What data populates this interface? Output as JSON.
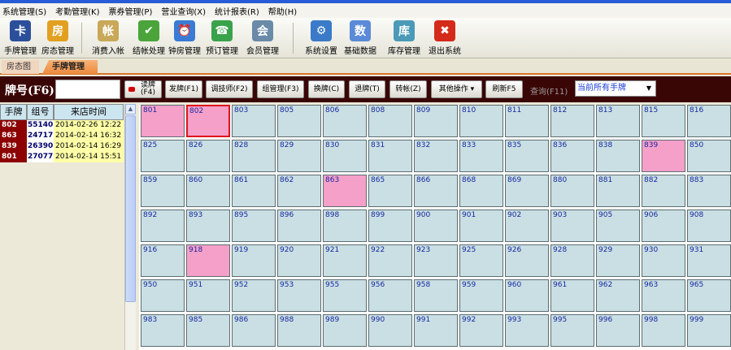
{
  "menu": [
    "系统管理(S)",
    "考勤管理(K)",
    "票券管理(P)",
    "营业查询(X)",
    "统计报表(R)",
    "帮助(H)"
  ],
  "toolbar": [
    {
      "label": "手牌管理",
      "icon": "hand-card-icon",
      "color": "#2c4f9b",
      "glyph": "卡"
    },
    {
      "label": "房态管理",
      "icon": "room-state-icon",
      "color": "#e2a020",
      "glyph": "房"
    },
    {
      "label": "消费入帐",
      "icon": "clipboard-icon",
      "color": "#c9a858",
      "glyph": "帐"
    },
    {
      "label": "结帐处理",
      "icon": "checkmark-icon",
      "color": "#4aa43a",
      "glyph": "✔"
    },
    {
      "label": "钟房管理",
      "icon": "clock-icon",
      "color": "#3a7bd5",
      "glyph": "⏰"
    },
    {
      "label": "预订管理",
      "icon": "phone-icon",
      "color": "#3aa24a",
      "glyph": "☎"
    },
    {
      "label": "会员管理",
      "icon": "member-icon",
      "color": "#6a8aa8",
      "glyph": "会"
    },
    {
      "label": "系统设置",
      "icon": "settings-icon",
      "color": "#3a7ac8",
      "glyph": "⚙"
    },
    {
      "label": "基础数据",
      "icon": "data-search-icon",
      "color": "#5a8ad8",
      "glyph": "数"
    },
    {
      "label": "库存管理",
      "icon": "inventory-icon",
      "color": "#4a9ab8",
      "glyph": "库"
    },
    {
      "label": "退出系统",
      "icon": "exit-icon",
      "color": "#d42a1a",
      "glyph": "✖"
    }
  ],
  "tabs": {
    "room_state": "房态图",
    "card_management": "手牌管理"
  },
  "query": {
    "card_label": "牌号(F6)",
    "card_input": "",
    "read_line1": "读牌",
    "read_line2": "(F4)",
    "buttons": [
      "发牌(F1)",
      "调技师(F2)",
      "组管理(F3)",
      "换牌(C)",
      "退牌(T)",
      "转帐(Z)",
      "其他操作 ▾",
      "刷新F5"
    ],
    "query_label": "查询(F11)",
    "filter_value": "当前所有手牌",
    "filter_arrow": "▼"
  },
  "list": {
    "headers": [
      "手牌",
      "组号",
      "来店时间"
    ],
    "rows": [
      {
        "card": "802",
        "group": "55140",
        "time": "2014-02-26 12:22"
      },
      {
        "card": "863",
        "group": "24717",
        "time": "2014-02-14 16:32"
      },
      {
        "card": "839",
        "group": "26390",
        "time": "2014-02-14 16:29"
      },
      {
        "card": "801",
        "group": "27077",
        "time": "2014-02-14 15:51"
      }
    ]
  },
  "scroll_up": "▲",
  "cards": [
    [
      "801",
      "802",
      "803",
      "805",
      "806",
      "808",
      "809",
      "810",
      "811",
      "812",
      "813",
      "815",
      "816"
    ],
    [
      "825",
      "826",
      "828",
      "829",
      "830",
      "831",
      "832",
      "833",
      "835",
      "836",
      "838",
      "839",
      "850"
    ],
    [
      "859",
      "860",
      "861",
      "862",
      "863",
      "865",
      "866",
      "868",
      "869",
      "880",
      "881",
      "882",
      "883"
    ],
    [
      "892",
      "893",
      "895",
      "896",
      "898",
      "899",
      "900",
      "901",
      "902",
      "903",
      "905",
      "906",
      "908"
    ],
    [
      "916",
      "918",
      "919",
      "920",
      "921",
      "922",
      "923",
      "925",
      "926",
      "928",
      "929",
      "930",
      "931"
    ],
    [
      "950",
      "951",
      "952",
      "953",
      "955",
      "956",
      "958",
      "959",
      "960",
      "961",
      "962",
      "963",
      "965"
    ],
    [
      "983",
      "985",
      "986",
      "988",
      "989",
      "990",
      "991",
      "992",
      "993",
      "995",
      "996",
      "998",
      "999"
    ]
  ],
  "occupied": [
    "801",
    "802",
    "839",
    "863",
    "918"
  ],
  "selected": "802",
  "colors": {
    "occupied": "#f5a0c9",
    "free": "#c9dfe3",
    "selected_border": "#e0141a"
  }
}
